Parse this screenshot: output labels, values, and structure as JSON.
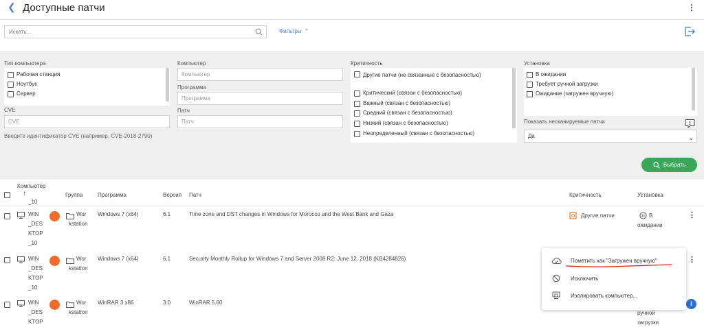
{
  "header": {
    "title": "Доступные патчи"
  },
  "search": {
    "placeholder": "Искать..."
  },
  "filters_label": "Фильтры",
  "filters": {
    "computer_type": {
      "label": "Тип компьютера",
      "options": [
        "Рабочая станция",
        "Ноутбук",
        "Сервер"
      ]
    },
    "cve": {
      "label": "CVE",
      "placeholder": "CVE",
      "help": "Введите идентификатор CVE (например, CVE-2018-2790)"
    },
    "computer": {
      "label": "Компьютер",
      "placeholder": "Компьютер"
    },
    "program": {
      "label": "Программа",
      "placeholder": "Программа"
    },
    "patch": {
      "label": "Патч",
      "placeholder": "Патч"
    },
    "criticality": {
      "label": "Критичность",
      "options": [
        "Другие патчи (не связанные с безопасностью)",
        "Критический (связан с безопасностью)",
        "Важный (связан с безопасностью)",
        "Средний (связан с безопасностью)",
        "Низкий (связан с безопасностью)",
        "Неопределенный (связан с безопасностью)"
      ]
    },
    "install": {
      "label": "Установка",
      "options": [
        "В ожидании",
        "Требует ручной загрузки",
        "Ожидание (загружен вручную)"
      ]
    },
    "show_unscanned": {
      "label": "Показать несканируемые патчи",
      "value": "Да"
    },
    "choose_button": "Выбрать"
  },
  "table": {
    "columns": {
      "computer": "Компьютер",
      "group": "Группа",
      "program": "Программа",
      "version": "Версия",
      "patch": "Патч",
      "criticality": "Критичность",
      "install": "Установка"
    },
    "partial_top": "_10",
    "rows": [
      {
        "computer": [
          "WIN",
          "_DES",
          "KTOP",
          "_10"
        ],
        "group": [
          "Wor",
          "kstation"
        ],
        "program": "Windows 7 (x64)",
        "version": "6.1",
        "patch": "Time zone and DST changes in Windows for Morocco and the West Bank and Gaza",
        "criticality": "Другие патчи",
        "install": [
          "В",
          "ожидании"
        ]
      },
      {
        "computer": [
          "WIN",
          "_DES",
          "KTOP",
          "_10"
        ],
        "group": [
          "Wor",
          "kstation"
        ],
        "program": "Windows 7 (x64)",
        "version": "6.1",
        "patch": "Security Monthly Rollup for Windows 7 and Server 2008 R2: June 12, 2018 (KB4284826)"
      },
      {
        "computer": [
          "WIN",
          "_DES",
          "KTOP"
        ],
        "group": [
          "Wor",
          "kstation"
        ],
        "program": "WinRAR 3 x86",
        "version": "3.0",
        "patch": "WinRAR 5.60",
        "install": [
          "ручной",
          "загрузки"
        ]
      }
    ]
  },
  "context_menu": {
    "items": [
      "Пометить как \"Загружен вручную\"",
      "Исключить",
      "Изолировать компьютер..."
    ]
  },
  "colors": {
    "accent": "#4a78d4",
    "green": "#3aa65a",
    "device_badge": "#f26b2c",
    "underline": "#e0191c"
  }
}
